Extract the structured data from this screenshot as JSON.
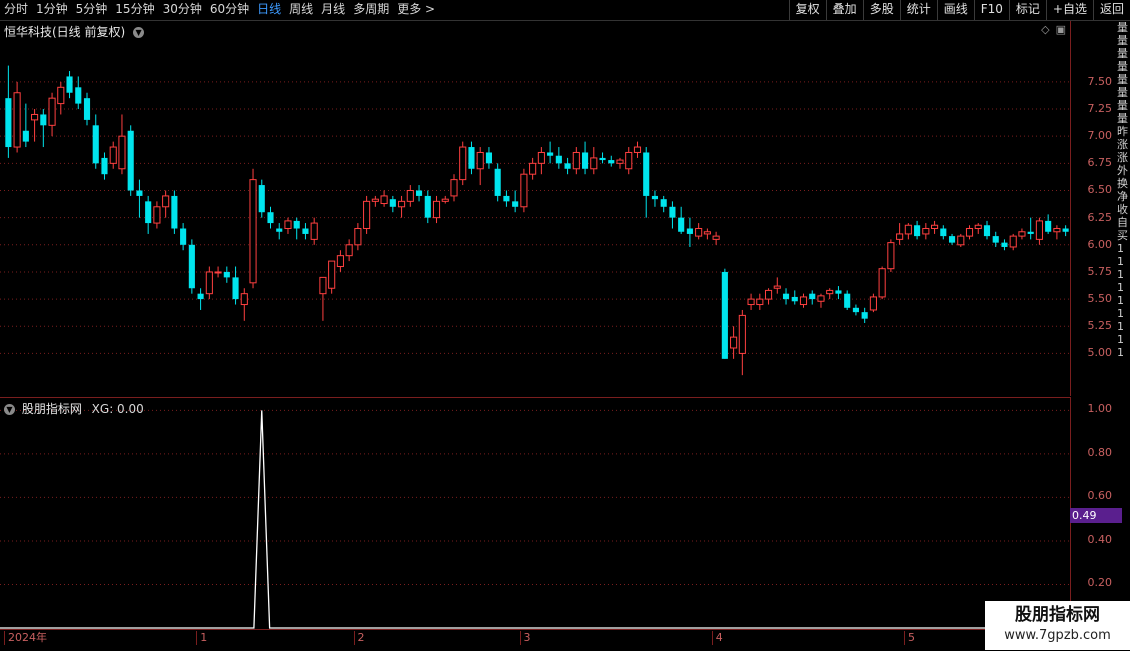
{
  "toolbar": {
    "timeframes": [
      "分时",
      "1分钟",
      "5分钟",
      "15分钟",
      "30分钟",
      "60分钟",
      "日线",
      "周线",
      "月线",
      "多周期",
      "更多 >"
    ],
    "active_timeframe": "日线",
    "tools": [
      "复权",
      "叠加",
      "多股",
      "统计",
      "画线",
      "F10",
      "标记",
      "+自选",
      "返回"
    ]
  },
  "main": {
    "title": "恒华科技(日线 前复权)",
    "title_icon": "chevron-down-icon",
    "y_ticks": [
      "7.50",
      "7.25",
      "7.00",
      "6.75",
      "6.50",
      "6.25",
      "6.00",
      "5.75",
      "5.50",
      "5.25",
      "5.00"
    ],
    "y_values": [
      7.5,
      7.25,
      7.0,
      6.75,
      6.5,
      6.25,
      6.0,
      5.75,
      5.5,
      5.25,
      5.0
    ],
    "y_range": [
      4.7,
      7.95
    ]
  },
  "indicator": {
    "title": "股朋指标网",
    "xg_label": "XG: 0.00",
    "y_ticks": [
      "1.00",
      "0.80",
      "0.60",
      "0.40",
      "0.20"
    ],
    "y_values": [
      1.0,
      0.8,
      0.6,
      0.4,
      0.2
    ],
    "y_range": [
      0,
      1.02
    ],
    "marker_value": "0.49",
    "signal_bar_index": 29
  },
  "xaxis": {
    "labels": [
      "2024年",
      "1",
      "2",
      "3",
      "4",
      "5"
    ],
    "label_bar_index": [
      0,
      22,
      40,
      59,
      81,
      103
    ]
  },
  "right_strip": [
    "量",
    "量",
    "量",
    "量",
    "量",
    "量",
    "量",
    "量",
    "昨",
    "涨",
    "涨",
    "外",
    "换",
    "净",
    "收",
    "自",
    "买",
    "1",
    "1",
    "1",
    "1",
    "1",
    "1",
    "1",
    "1",
    "1"
  ],
  "colors": {
    "up": "#ff4040",
    "down": "#00e5ee",
    "grid": "#7a1e1e",
    "bg": "#000000",
    "marker": "#5a1f8e"
  },
  "watermark": {
    "line1": "股朋指标网",
    "line2": "www.7gpzb.com"
  },
  "chart_data": {
    "type": "candlestick",
    "series": [
      {
        "values": [
          [
            7.35,
            7.65,
            6.8,
            6.9
          ],
          [
            6.9,
            7.5,
            6.85,
            7.4
          ],
          [
            7.05,
            7.3,
            6.9,
            6.95
          ],
          [
            7.15,
            7.25,
            6.95,
            7.2
          ],
          [
            7.2,
            7.25,
            6.9,
            7.1
          ],
          [
            7.1,
            7.4,
            7.0,
            7.35
          ],
          [
            7.3,
            7.5,
            7.2,
            7.45
          ],
          [
            7.55,
            7.6,
            7.35,
            7.4
          ],
          [
            7.45,
            7.55,
            7.25,
            7.3
          ],
          [
            7.35,
            7.4,
            7.1,
            7.15
          ],
          [
            7.1,
            7.2,
            6.7,
            6.75
          ],
          [
            6.8,
            6.85,
            6.6,
            6.65
          ],
          [
            6.75,
            6.95,
            6.7,
            6.9
          ],
          [
            6.7,
            7.2,
            6.65,
            7.0
          ],
          [
            7.05,
            7.1,
            6.45,
            6.5
          ],
          [
            6.5,
            6.6,
            6.25,
            6.45
          ],
          [
            6.4,
            6.45,
            6.1,
            6.2
          ],
          [
            6.2,
            6.4,
            6.15,
            6.35
          ],
          [
            6.35,
            6.5,
            6.25,
            6.45
          ],
          [
            6.45,
            6.5,
            6.1,
            6.15
          ],
          [
            6.15,
            6.2,
            5.95,
            6.0
          ],
          [
            6.0,
            6.05,
            5.55,
            5.6
          ],
          [
            5.55,
            5.6,
            5.4,
            5.5
          ],
          [
            5.55,
            5.8,
            5.5,
            5.75
          ],
          [
            5.75,
            5.8,
            5.7,
            5.75
          ],
          [
            5.75,
            5.8,
            5.65,
            5.7
          ],
          [
            5.7,
            5.8,
            5.45,
            5.5
          ],
          [
            5.45,
            5.6,
            5.3,
            5.55
          ],
          [
            5.65,
            6.7,
            5.6,
            6.6
          ],
          [
            6.55,
            6.6,
            6.25,
            6.3
          ],
          [
            6.3,
            6.35,
            6.15,
            6.2
          ],
          [
            6.15,
            6.2,
            6.05,
            6.12
          ],
          [
            6.15,
            6.25,
            6.1,
            6.22
          ],
          [
            6.22,
            6.25,
            6.05,
            6.15
          ],
          [
            6.15,
            6.2,
            6.05,
            6.1
          ],
          [
            6.05,
            6.25,
            6.0,
            6.2
          ],
          [
            5.55,
            5.65,
            5.3,
            5.7
          ],
          [
            5.6,
            5.85,
            5.55,
            5.85
          ],
          [
            5.8,
            5.95,
            5.75,
            5.9
          ],
          [
            5.9,
            6.05,
            5.85,
            6.0
          ],
          [
            6.0,
            6.2,
            5.95,
            6.15
          ],
          [
            6.15,
            6.45,
            6.1,
            6.4
          ],
          [
            6.4,
            6.45,
            6.35,
            6.42
          ],
          [
            6.38,
            6.5,
            6.35,
            6.45
          ],
          [
            6.42,
            6.45,
            6.3,
            6.35
          ],
          [
            6.35,
            6.45,
            6.25,
            6.4
          ],
          [
            6.4,
            6.55,
            6.35,
            6.5
          ],
          [
            6.5,
            6.55,
            6.4,
            6.45
          ],
          [
            6.45,
            6.5,
            6.2,
            6.25
          ],
          [
            6.25,
            6.45,
            6.2,
            6.4
          ],
          [
            6.4,
            6.45,
            6.38,
            6.42
          ],
          [
            6.45,
            6.65,
            6.4,
            6.6
          ],
          [
            6.6,
            6.95,
            6.55,
            6.9
          ],
          [
            6.9,
            6.95,
            6.65,
            6.7
          ],
          [
            6.7,
            6.9,
            6.55,
            6.85
          ],
          [
            6.85,
            6.9,
            6.7,
            6.75
          ],
          [
            6.7,
            6.75,
            6.4,
            6.45
          ],
          [
            6.45,
            6.5,
            6.35,
            6.4
          ],
          [
            6.4,
            6.5,
            6.3,
            6.35
          ],
          [
            6.35,
            6.7,
            6.3,
            6.65
          ],
          [
            6.65,
            6.8,
            6.6,
            6.75
          ],
          [
            6.75,
            6.9,
            6.65,
            6.85
          ],
          [
            6.85,
            6.95,
            6.75,
            6.82
          ],
          [
            6.82,
            6.9,
            6.7,
            6.75
          ],
          [
            6.75,
            6.8,
            6.65,
            6.7
          ],
          [
            6.7,
            6.9,
            6.65,
            6.85
          ],
          [
            6.85,
            6.95,
            6.65,
            6.7
          ],
          [
            6.7,
            6.9,
            6.65,
            6.8
          ],
          [
            6.8,
            6.85,
            6.75,
            6.78
          ],
          [
            6.78,
            6.82,
            6.72,
            6.75
          ],
          [
            6.75,
            6.8,
            6.7,
            6.78
          ],
          [
            6.7,
            6.9,
            6.65,
            6.85
          ],
          [
            6.85,
            6.95,
            6.8,
            6.9
          ],
          [
            6.85,
            6.9,
            6.25,
            6.45
          ],
          [
            6.45,
            6.5,
            6.35,
            6.42
          ],
          [
            6.42,
            6.45,
            6.3,
            6.35
          ],
          [
            6.35,
            6.4,
            6.15,
            6.25
          ],
          [
            6.25,
            6.35,
            6.1,
            6.12
          ],
          [
            6.15,
            6.25,
            5.98,
            6.1
          ],
          [
            6.08,
            6.2,
            6.05,
            6.15
          ],
          [
            6.1,
            6.15,
            6.05,
            6.12
          ],
          [
            6.05,
            6.12,
            6.0,
            6.08
          ],
          [
            5.75,
            5.78,
            4.95,
            4.95
          ],
          [
            5.05,
            5.25,
            4.95,
            5.15
          ],
          [
            5.0,
            5.4,
            4.8,
            5.35
          ],
          [
            5.45,
            5.55,
            5.4,
            5.5
          ],
          [
            5.45,
            5.55,
            5.4,
            5.5
          ],
          [
            5.5,
            5.6,
            5.45,
            5.58
          ],
          [
            5.6,
            5.7,
            5.55,
            5.62
          ],
          [
            5.55,
            5.6,
            5.45,
            5.5
          ],
          [
            5.52,
            5.58,
            5.45,
            5.48
          ],
          [
            5.45,
            5.55,
            5.42,
            5.52
          ],
          [
            5.55,
            5.58,
            5.45,
            5.5
          ],
          [
            5.48,
            5.55,
            5.42,
            5.53
          ],
          [
            5.55,
            5.6,
            5.5,
            5.58
          ],
          [
            5.58,
            5.62,
            5.5,
            5.55
          ],
          [
            5.55,
            5.58,
            5.4,
            5.42
          ],
          [
            5.42,
            5.45,
            5.35,
            5.38
          ],
          [
            5.38,
            5.42,
            5.28,
            5.32
          ],
          [
            5.4,
            5.55,
            5.38,
            5.52
          ],
          [
            5.52,
            5.8,
            5.5,
            5.78
          ],
          [
            5.78,
            6.05,
            5.75,
            6.02
          ],
          [
            6.05,
            6.2,
            6.0,
            6.1
          ],
          [
            6.1,
            6.2,
            6.05,
            6.18
          ],
          [
            6.18,
            6.22,
            6.05,
            6.08
          ],
          [
            6.1,
            6.2,
            6.05,
            6.15
          ],
          [
            6.15,
            6.22,
            6.1,
            6.18
          ],
          [
            6.15,
            6.18,
            6.05,
            6.08
          ],
          [
            6.08,
            6.1,
            6.0,
            6.02
          ],
          [
            6.0,
            6.1,
            5.98,
            6.08
          ],
          [
            6.08,
            6.18,
            6.05,
            6.15
          ],
          [
            6.15,
            6.2,
            6.1,
            6.18
          ],
          [
            6.18,
            6.22,
            6.05,
            6.08
          ],
          [
            6.08,
            6.12,
            5.98,
            6.02
          ],
          [
            6.02,
            6.05,
            5.95,
            5.98
          ],
          [
            5.98,
            6.1,
            5.95,
            6.08
          ],
          [
            6.08,
            6.15,
            6.05,
            6.12
          ],
          [
            6.12,
            6.25,
            6.05,
            6.1
          ],
          [
            6.05,
            6.25,
            6.0,
            6.22
          ],
          [
            6.22,
            6.28,
            6.1,
            6.12
          ],
          [
            6.12,
            6.18,
            6.05,
            6.15
          ],
          [
            6.15,
            6.18,
            6.08,
            6.12
          ]
        ]
      }
    ],
    "ylim": [
      4.7,
      7.95
    ],
    "x_labels": [
      "2024年",
      "1",
      "2",
      "3",
      "4",
      "5"
    ]
  }
}
